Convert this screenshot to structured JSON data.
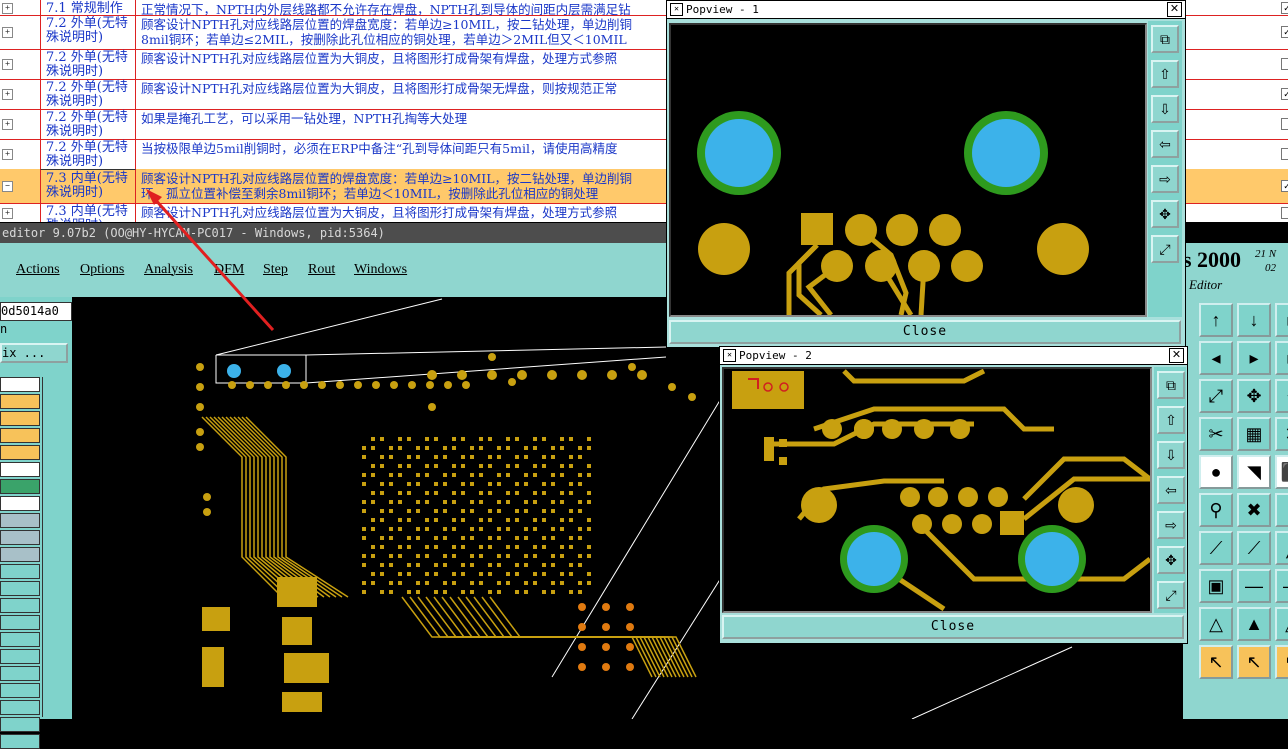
{
  "spreadsheet": {
    "rows": [
      {
        "section": "7.1 常规制作",
        "desc": [
          "正常情况下，NPTH内外层线路都不允许存在焊盘，NPTH孔到导体的间距内层需满足钻"
        ],
        "selected": false,
        "checked": true
      },
      {
        "section": "7.2 外单(无特殊说明时)",
        "desc": [
          "顾客设计NPTH孔对应线路层位置的焊盘宽度：若单边≥10MIL，按二钻处理，单边削铜",
          "8mil铜环；若单边≤2MIL，按删除此孔位相应的铜处理，若单边＞2MIL但又＜10MIL"
        ],
        "selected": false,
        "checked": true
      },
      {
        "section": "7.2 外单(无特殊说明时)",
        "desc": [
          "顾客设计NPTH孔对应线路层位置为大铜皮，且将图形打成骨架有焊盘，处理方式参照"
        ],
        "selected": false,
        "checked": false
      },
      {
        "section": "7.2 外单(无特殊说明时)",
        "desc": [
          "顾客设计NPTH孔对应线路层位置为大铜皮，且将图形打成骨架无焊盘，则按规范正常"
        ],
        "selected": false,
        "checked": true
      },
      {
        "section": "7.2 外单(无特殊说明时)",
        "desc": [
          "如果是掩孔工艺，可以采用一钻处理，NPTH孔掏等大处理"
        ],
        "selected": false,
        "checked": false
      },
      {
        "section": "7.2 外单(无特殊说明时)",
        "desc": [
          "当按极限单边5mil削铜时，必须在ERP中备注“孔到导体间距只有5mil，请使用高精度"
        ],
        "selected": false,
        "checked": false
      },
      {
        "section": "7.3 内单(无特殊说明时)",
        "desc": [
          "顾客设计NPTH孔对应线路层位置的焊盘宽度：若单边≥10MIL，按二钻处理，单边削铜",
          "环，孤立位置补偿至剩余8mil铜环；若单边＜10MIL，按删除此孔位相应的铜处理"
        ],
        "selected": true,
        "checked": true
      },
      {
        "section": "7.3 内单(无特殊说明时)",
        "desc": [
          "顾客设计NPTH孔对应线路层位置为大铜皮，且将图形打成骨架有焊盘，处理方式参照"
        ],
        "selected": false,
        "checked": false
      }
    ]
  },
  "editor": {
    "window_title": "editor 9.07b2 (OO@HY-HYCAM-PC017 - Windows, pid:5364)",
    "menu": [
      "Actions",
      "Options",
      "Analysis",
      "DFM",
      "Step",
      "Rout",
      "Windows"
    ],
    "left_panel": {
      "job_label": "0d5014a0",
      "label2": "n",
      "matrix_button": "ix ..."
    },
    "brand": {
      "name": "s 2000",
      "sub": "Editor",
      "date1": "21 N",
      "date2": "02"
    }
  },
  "popview1": {
    "title": "Popview - 1",
    "close_label": "Close"
  },
  "popview2": {
    "title": "Popview - 2",
    "close_label": "Close"
  },
  "colors": {
    "copper": "#c8a010",
    "drill": "#3cb2ea",
    "ring": "#2e9a1e",
    "menu_bg": "#8fd6cf",
    "arrow": "#e02020"
  }
}
